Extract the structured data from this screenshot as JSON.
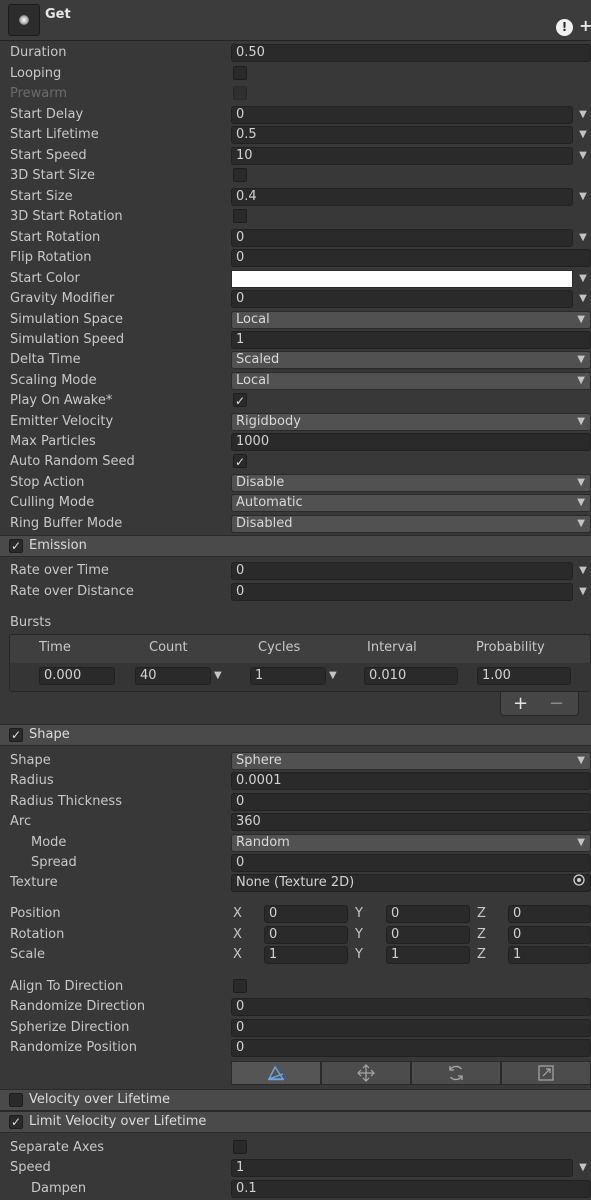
{
  "header": {
    "title": "Get",
    "warning_glyph": "!",
    "add_glyph": "+"
  },
  "main": {
    "duration": {
      "label": "Duration",
      "value": "0.50"
    },
    "looping": {
      "label": "Looping",
      "checked": false
    },
    "prewarm": {
      "label": "Prewarm",
      "checked": false,
      "disabled": true
    },
    "start_delay": {
      "label": "Start Delay",
      "value": "0"
    },
    "start_lifetime": {
      "label": "Start Lifetime",
      "value": "0.5"
    },
    "start_speed": {
      "label": "Start Speed",
      "value": "10"
    },
    "start_size_3d": {
      "label": "3D Start Size",
      "checked": false
    },
    "start_size": {
      "label": "Start Size",
      "value": "0.4"
    },
    "start_rotation_3d": {
      "label": "3D Start Rotation",
      "checked": false
    },
    "start_rotation": {
      "label": "Start Rotation",
      "value": "0"
    },
    "flip_rotation": {
      "label": "Flip Rotation",
      "value": "0"
    },
    "start_color": {
      "label": "Start Color",
      "color": "#ffffff"
    },
    "gravity_modifier": {
      "label": "Gravity Modifier",
      "value": "0"
    },
    "simulation_space": {
      "label": "Simulation Space",
      "value": "Local"
    },
    "simulation_speed": {
      "label": "Simulation Speed",
      "value": "1"
    },
    "delta_time": {
      "label": "Delta Time",
      "value": "Scaled"
    },
    "scaling_mode": {
      "label": "Scaling Mode",
      "value": "Local"
    },
    "play_on_awake": {
      "label": "Play On Awake*",
      "checked": true
    },
    "emitter_velocity": {
      "label": "Emitter Velocity",
      "value": "Rigidbody"
    },
    "max_particles": {
      "label": "Max Particles",
      "value": "1000"
    },
    "auto_random_seed": {
      "label": "Auto Random Seed",
      "checked": true
    },
    "stop_action": {
      "label": "Stop Action",
      "value": "Disable"
    },
    "culling_mode": {
      "label": "Culling Mode",
      "value": "Automatic"
    },
    "ring_buffer_mode": {
      "label": "Ring Buffer Mode",
      "value": "Disabled"
    }
  },
  "emission": {
    "title": "Emission",
    "enabled": true,
    "rate_over_time": {
      "label": "Rate over Time",
      "value": "0"
    },
    "rate_over_distance": {
      "label": "Rate over Distance",
      "value": "0"
    },
    "bursts_label": "Bursts",
    "bursts_columns": [
      "Time",
      "Count",
      "Cycles",
      "Interval",
      "Probability"
    ],
    "burst": {
      "time": "0.000",
      "count": "40",
      "cycles": "1",
      "interval": "0.010",
      "probability": "1.00"
    },
    "add_glyph": "+",
    "remove_glyph": "−"
  },
  "shape": {
    "title": "Shape",
    "enabled": true,
    "shape": {
      "label": "Shape",
      "value": "Sphere"
    },
    "radius": {
      "label": "Radius",
      "value": "0.0001"
    },
    "radius_thickness": {
      "label": "Radius Thickness",
      "value": "0"
    },
    "arc": {
      "label": "Arc",
      "value": "360"
    },
    "mode": {
      "label": "Mode",
      "value": "Random"
    },
    "spread": {
      "label": "Spread",
      "value": "0"
    },
    "texture": {
      "label": "Texture",
      "value": "None (Texture 2D)"
    },
    "axis_labels": [
      "X",
      "Y",
      "Z"
    ],
    "position": {
      "label": "Position",
      "x": "0",
      "y": "0",
      "z": "0"
    },
    "rotation": {
      "label": "Rotation",
      "x": "0",
      "y": "0",
      "z": "0"
    },
    "scale": {
      "label": "Scale",
      "x": "1",
      "y": "1",
      "z": "1"
    },
    "align_to_direction": {
      "label": "Align To Direction",
      "checked": false
    },
    "randomize_direction": {
      "label": "Randomize Direction",
      "value": "0"
    },
    "spherize_direction": {
      "label": "Spherize Direction",
      "value": "0"
    },
    "randomize_position": {
      "label": "Randomize Position",
      "value": "0"
    },
    "tools": [
      "edit-shape-icon",
      "move-icon",
      "rotate-icon",
      "scale-icon"
    ]
  },
  "velocity_over_lifetime": {
    "title": "Velocity over Lifetime",
    "enabled": false
  },
  "limit_velocity_over_lifetime": {
    "title": "Limit Velocity over Lifetime",
    "enabled": true,
    "separate_axes": {
      "label": "Separate Axes",
      "checked": false
    },
    "speed": {
      "label": "Speed",
      "value": "1"
    },
    "dampen": {
      "label": "Dampen",
      "value": "0.1"
    }
  },
  "glyphs": {
    "check": "✓",
    "caret": "▼"
  },
  "colors": {
    "background": "#383838",
    "field": "#2a2a2a",
    "dropdown": "#515151",
    "section": "#4a4a4a"
  }
}
